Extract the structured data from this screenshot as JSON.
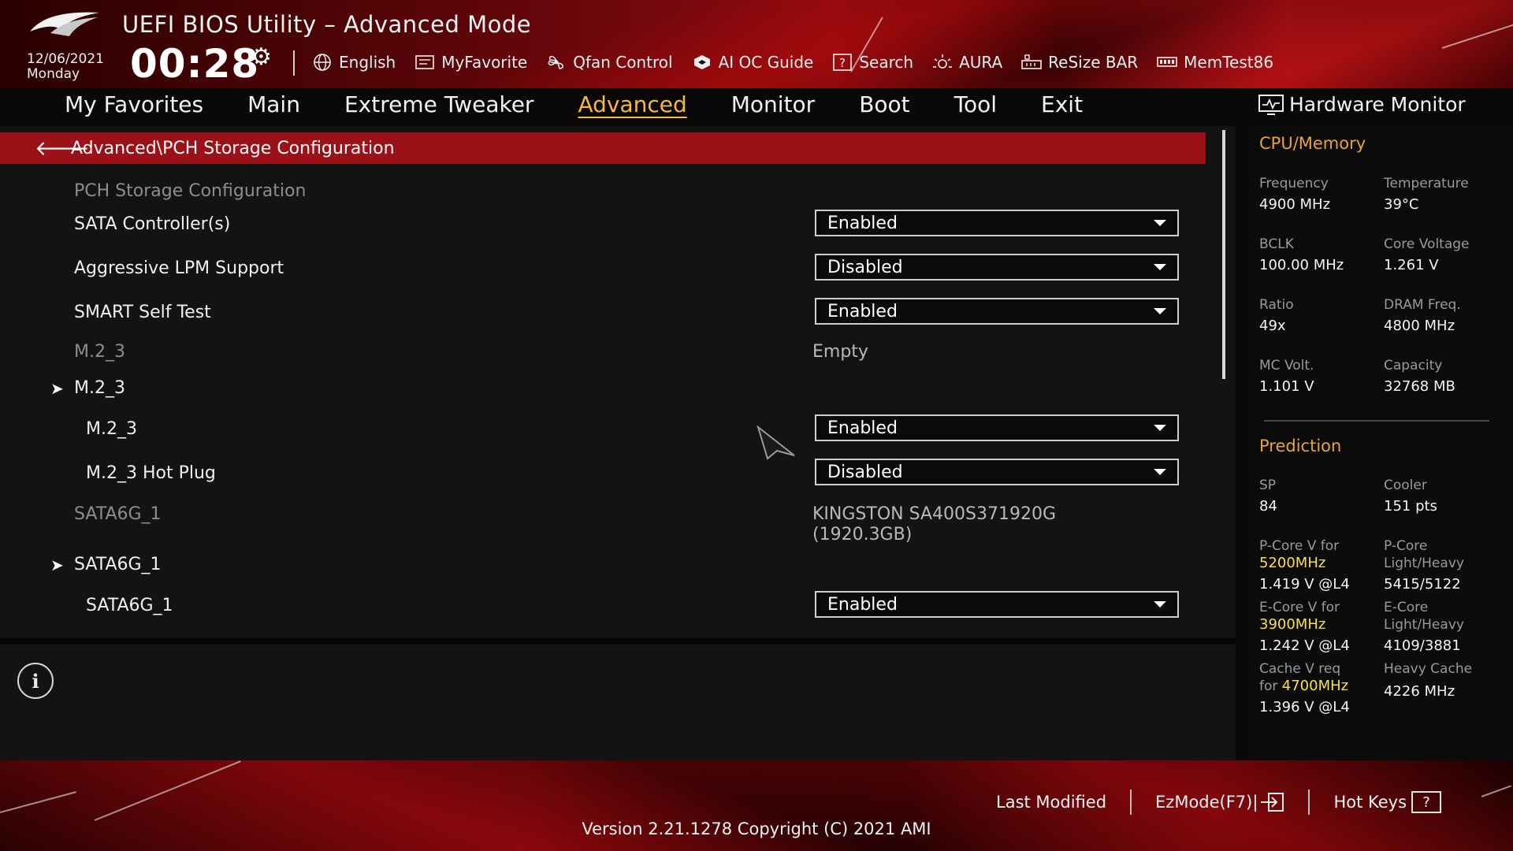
{
  "header": {
    "title": "UEFI BIOS Utility – Advanced Mode",
    "date": "12/06/2021",
    "day": "Monday",
    "time": "00:28",
    "toolbar": [
      {
        "label": "English",
        "icon": "globe-icon"
      },
      {
        "label": "MyFavorite",
        "icon": "favorite-icon"
      },
      {
        "label": "Qfan Control",
        "icon": "fan-icon"
      },
      {
        "label": "AI OC Guide",
        "icon": "ai-guide-icon"
      },
      {
        "label": "Search",
        "icon": "search-icon"
      },
      {
        "label": "AURA",
        "icon": "aura-icon"
      },
      {
        "label": "ReSize BAR",
        "icon": "resize-bar-icon"
      },
      {
        "label": "MemTest86",
        "icon": "memtest-icon"
      }
    ]
  },
  "nav": {
    "items": [
      "My Favorites",
      "Main",
      "Extreme Tweaker",
      "Advanced",
      "Monitor",
      "Boot",
      "Tool",
      "Exit"
    ],
    "active": "Advanced"
  },
  "breadcrumb": "Advanced\\PCH Storage Configuration",
  "settings": {
    "section_title": "PCH Storage Configuration",
    "sata_controllers": {
      "label": "SATA Controller(s)",
      "value": "Enabled"
    },
    "aggressive_lpm": {
      "label": "Aggressive LPM Support",
      "value": "Disabled"
    },
    "smart_self_test": {
      "label": "SMART Self Test",
      "value": "Enabled"
    },
    "m2_3_status": {
      "label": "M.2_3",
      "value": "Empty"
    },
    "m2_3_group": {
      "label": "M.2_3"
    },
    "m2_3_port": {
      "label": "M.2_3",
      "value": "Enabled"
    },
    "m2_3_hotplug": {
      "label": "M.2_3 Hot Plug",
      "value": "Disabled"
    },
    "sata6g_1_status": {
      "label": "SATA6G_1",
      "value_line1": "KINGSTON SA400S371920G",
      "value_line2": "(1920.3GB)"
    },
    "sata6g_1_group": {
      "label": "SATA6G_1"
    },
    "sata6g_1_port": {
      "label": "SATA6G_1",
      "value": "Enabled"
    }
  },
  "hardware_monitor": {
    "title": "Hardware Monitor",
    "cpu_memory": {
      "heading": "CPU/Memory",
      "frequency": {
        "label": "Frequency",
        "value": "4900 MHz"
      },
      "temperature": {
        "label": "Temperature",
        "value": "39°C"
      },
      "bclk": {
        "label": "BCLK",
        "value": "100.00 MHz"
      },
      "core_voltage": {
        "label": "Core Voltage",
        "value": "1.261 V"
      },
      "ratio": {
        "label": "Ratio",
        "value": "49x"
      },
      "dram_freq": {
        "label": "DRAM Freq.",
        "value": "4800 MHz"
      },
      "mc_volt": {
        "label": "MC Volt.",
        "value": "1.101 V"
      },
      "capacity": {
        "label": "Capacity",
        "value": "32768 MB"
      }
    },
    "prediction": {
      "heading": "Prediction",
      "sp": {
        "label": "SP",
        "value": "84"
      },
      "cooler": {
        "label": "Cooler",
        "value": "151 pts"
      },
      "pcore_v": {
        "label": "P-Core V for",
        "freq": "5200MHz",
        "value": "1.419 V @L4"
      },
      "pcore_lh": {
        "label1": "P-Core",
        "label2": "Light/Heavy",
        "value": "5415/5122"
      },
      "ecore_v": {
        "label": "E-Core V for",
        "freq": "3900MHz",
        "value": "1.242 V @L4"
      },
      "ecore_lh": {
        "label1": "E-Core",
        "label2": "Light/Heavy",
        "value": "4109/3881"
      },
      "cache_v": {
        "label1": "Cache V req",
        "label2": "for",
        "freq": "4700MHz",
        "value": "1.396 V @L4"
      },
      "heavy_cache": {
        "label": "Heavy Cache",
        "value": "4226 MHz"
      }
    }
  },
  "footer": {
    "last_modified": "Last Modified",
    "ezmode": "EzMode(F7)|",
    "hot_keys": "Hot Keys",
    "version": "Version 2.21.1278 Copyright (C) 2021 AMI"
  },
  "colors": {
    "accent": "#f5b74a",
    "breadcrumb_bg": "#9a1218",
    "highlight_freq": "#f7e04a",
    "section_heading": "#e8a23a"
  }
}
